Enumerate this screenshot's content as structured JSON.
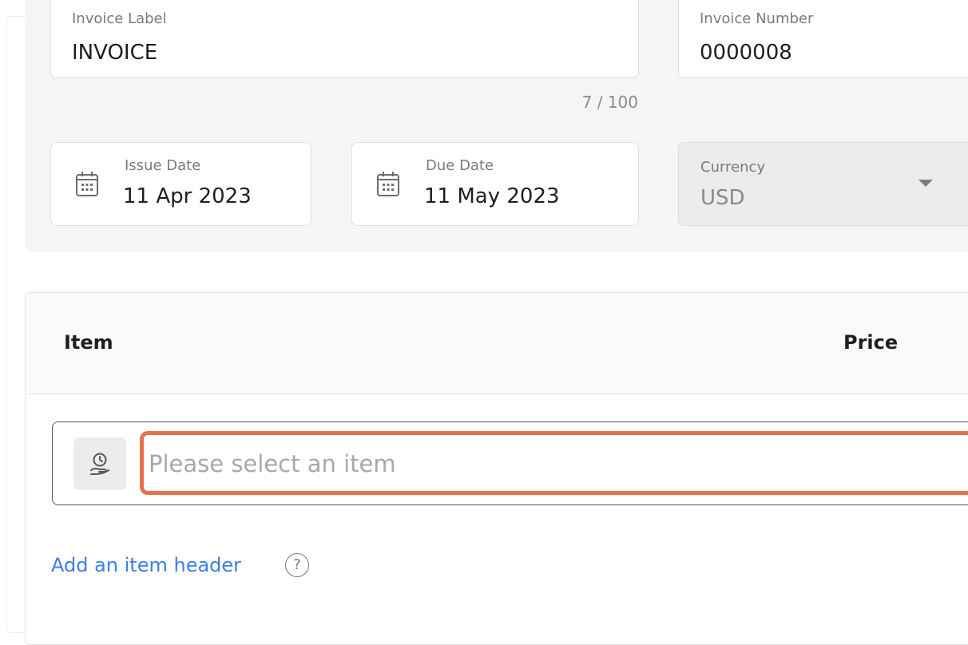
{
  "invoice_label": {
    "label": "Invoice Label",
    "value": "INVOICE",
    "counter": "7 / 100"
  },
  "invoice_number": {
    "label": "Invoice Number",
    "value": "0000008"
  },
  "issue_date": {
    "label": "Issue Date",
    "value": "11 Apr 2023",
    "icon": "calendar-icon"
  },
  "due_date": {
    "label": "Due Date",
    "value": "11 May 2023",
    "icon": "calendar-icon"
  },
  "currency": {
    "label": "Currency",
    "value": "USD",
    "icon": "chevron-down-icon"
  },
  "items_table": {
    "columns": [
      "Item",
      "Price"
    ],
    "item_icon": "item-hand-icon",
    "placeholder": "Please select an item"
  },
  "add_item_header": {
    "label": "Add an item header",
    "help_glyph": "?"
  },
  "colors": {
    "accent_link": "#3f7de8",
    "highlight": "#e5744e"
  }
}
